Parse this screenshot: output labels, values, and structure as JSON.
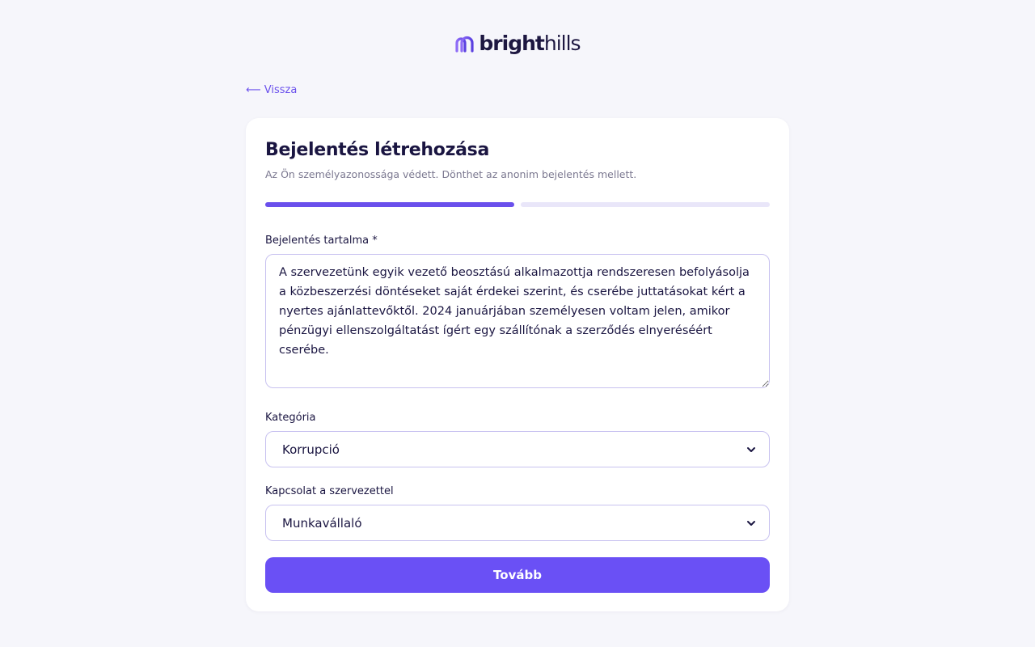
{
  "brand": {
    "name_bold": "bright",
    "name_light": "hills",
    "icon": "bridge-arch-icon",
    "accent_color": "#6a50ec"
  },
  "nav": {
    "back_label": "⟵ Vissza"
  },
  "form": {
    "title": "Bejelentés létrehozása",
    "subtitle": "Az Ön személyazonossága védett. Dönthet az anonim bejelentés mellett.",
    "progress": {
      "current_step": 1,
      "total_steps": 2
    },
    "content": {
      "label": "Bejelentés tartalma *",
      "value": "A szervezetünk egyik vezető beosztású alkalmazottja rendszeresen befolyásolja a közbeszerzési döntéseket saját érdekei szerint, és cserébe juttatásokat kért a nyertes ajánlattevőktől. 2024 januárjában személyesen voltam jelen, amikor pénzügyi ellenszolgáltatást ígért egy szállítónak a szerződés elnyeréséért cserébe."
    },
    "category": {
      "label": "Kategória",
      "selected": "Korrupció",
      "icon": "chevron-down-icon"
    },
    "relationship": {
      "label": "Kapcsolat a szervezettel",
      "selected": "Munkavállaló",
      "icon": "chevron-down-icon"
    },
    "submit_label": "Tovább"
  }
}
